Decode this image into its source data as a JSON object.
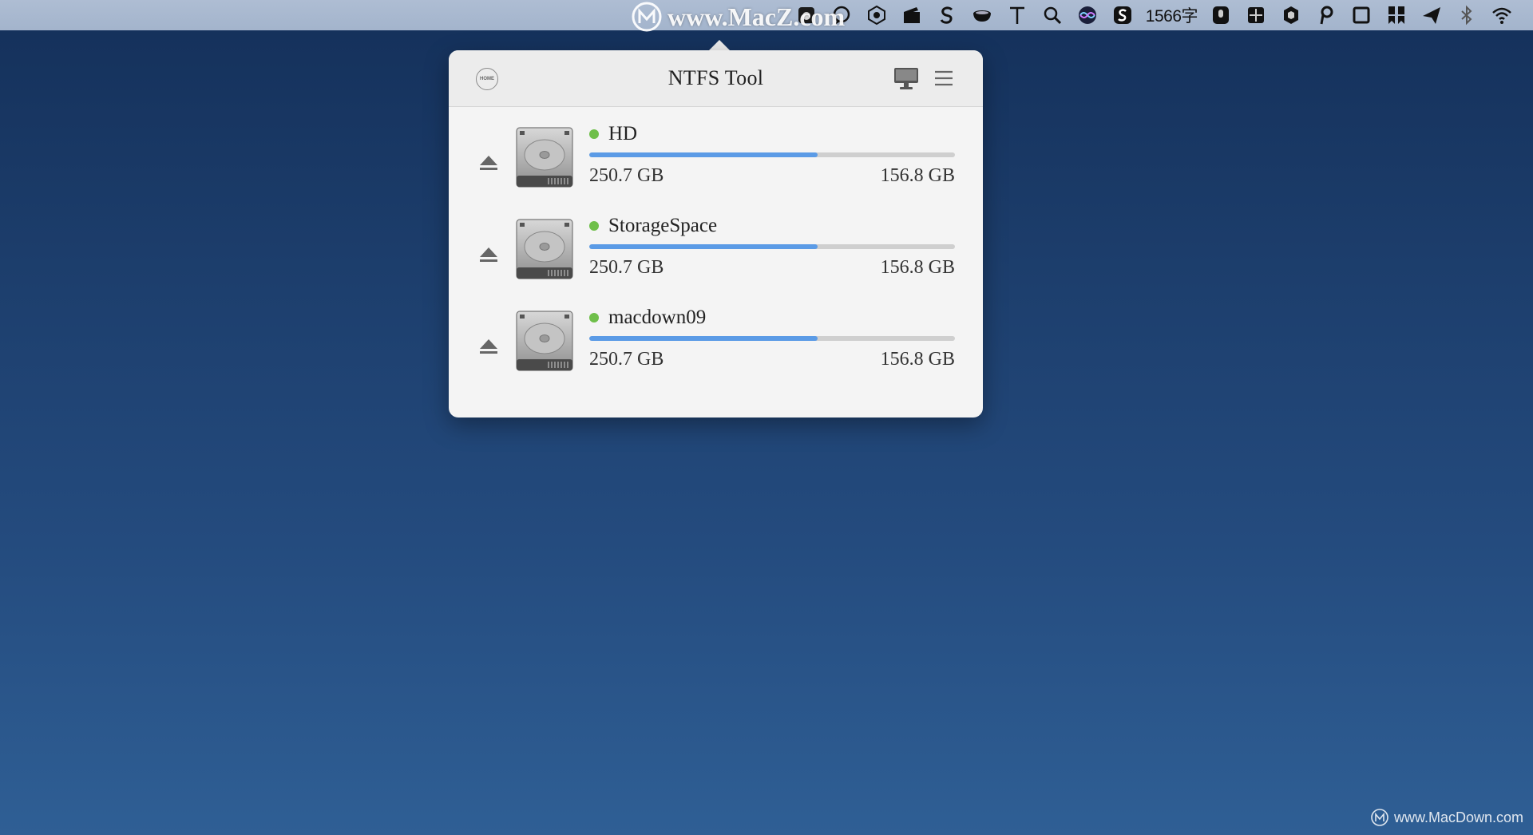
{
  "menubar": {
    "icons": [
      "apple-app-icon",
      "speech-bubble-icon",
      "hexagon-cube-icon",
      "film-clapper-icon",
      "s-script-icon",
      "coffee-cup-icon",
      "text-t-icon",
      "search-icon",
      "siri-icon",
      "sogou-s-icon"
    ],
    "word_count": "1566字",
    "right_icons": [
      "microphone-icon",
      "grid-box-icon",
      "shield-hexagon-icon",
      "p-pen-icon",
      "square-window-icon",
      "bookmark-grid-icon",
      "send-plane-icon",
      "bluetooth-icon",
      "wifi-icon"
    ]
  },
  "watermark_top": {
    "text": "www.MacZ.com"
  },
  "popover": {
    "title": "NTFS Tool",
    "home_label": "HOME",
    "drives": [
      {
        "name": "HD",
        "used_fraction": 0.625,
        "total": "250.7 GB",
        "free": "156.8 GB",
        "status": "mounted"
      },
      {
        "name": "StorageSpace",
        "used_fraction": 0.625,
        "total": "250.7 GB",
        "free": "156.8 GB",
        "status": "mounted"
      },
      {
        "name": "macdown09",
        "used_fraction": 0.625,
        "total": "250.7 GB",
        "free": "156.8 GB",
        "status": "mounted"
      }
    ]
  },
  "colors": {
    "status_green": "#6fbf4a",
    "usage_blue": "#5b9be6",
    "track_gray": "#cfcfcf"
  },
  "watermark_bottom": {
    "text": "www.MacDown.com"
  }
}
